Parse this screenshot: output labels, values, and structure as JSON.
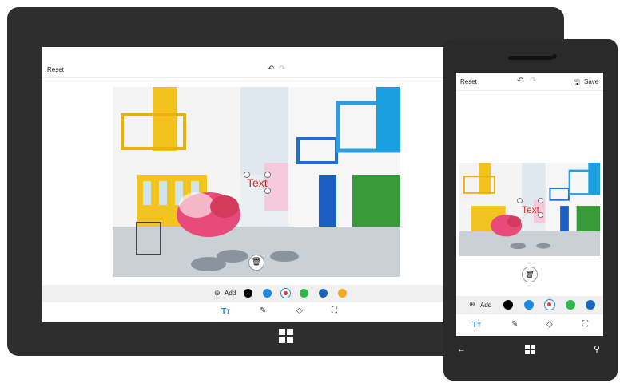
{
  "tablet": {
    "topbar": {
      "reset_label": "Reset"
    },
    "overlay_text": "Text",
    "colorbar": {
      "add_label": "Add"
    },
    "colors": [
      "#000000",
      "#1e88e5",
      "#e53935",
      "#2eb84b",
      "#1565c0",
      "#f5a623"
    ],
    "tools": [
      "text-tool",
      "brush-tool",
      "shapes-tool",
      "crop-tool"
    ]
  },
  "phone": {
    "topbar": {
      "reset_label": "Reset",
      "save_label": "Save"
    },
    "overlay_text": "Text",
    "colorbar": {
      "add_label": "Add"
    },
    "colors": [
      "#000000",
      "#1e88e5",
      "#e53935",
      "#2eb84b",
      "#1565c0"
    ]
  },
  "colors": {
    "frame": "#2e2e2e",
    "accent_blue": "#1e88e5",
    "text_red": "#d32f2f"
  }
}
